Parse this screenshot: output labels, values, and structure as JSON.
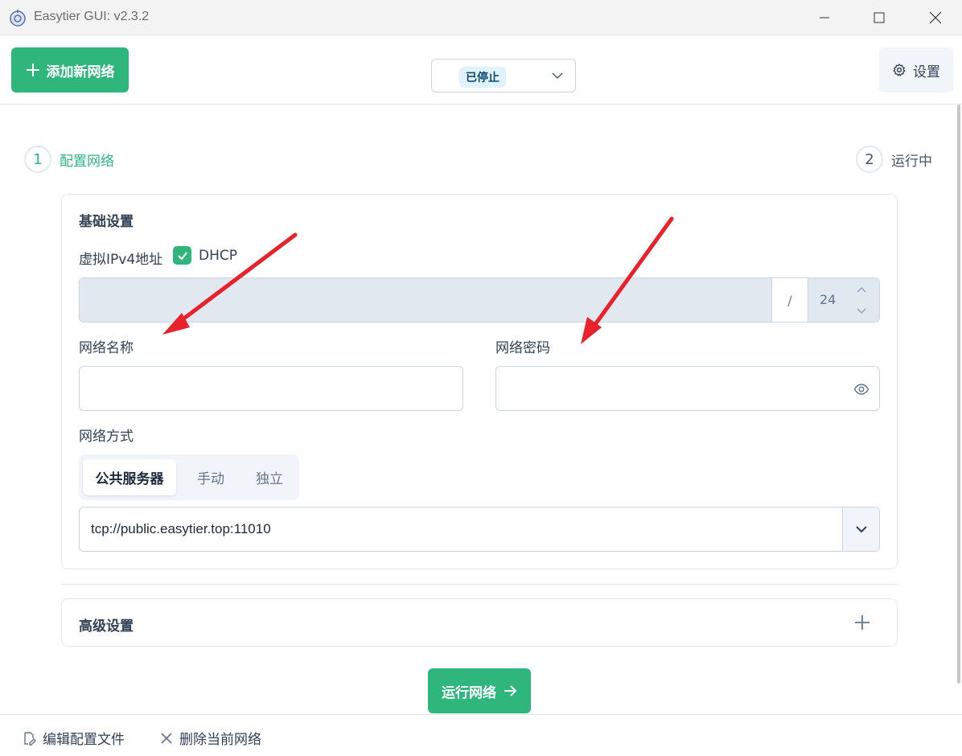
{
  "window": {
    "title": "Easytier GUI: v2.3.2"
  },
  "toolbar": {
    "add_network_label": "添加新网络",
    "status_label": "已停止",
    "settings_label": "设置"
  },
  "stepper": {
    "step1_num": "1",
    "step1_label": "配置网络",
    "step2_num": "2",
    "step2_label": "运行中"
  },
  "basic": {
    "title": "基础设置",
    "ipv4_label": "虚拟IPv4地址",
    "dhcp_label": "DHCP",
    "dhcp_checked": true,
    "ip_value": "",
    "slash": "/",
    "mask_value": "24",
    "network_name_label": "网络名称",
    "network_name_value": "",
    "network_secret_label": "网络密码",
    "network_secret_value": "",
    "network_mode_label": "网络方式",
    "modes": [
      "公共服务器",
      "手动",
      "独立"
    ],
    "selected_mode": "公共服务器",
    "server_value": "tcp://public.easytier.top:11010"
  },
  "advanced": {
    "title": "高级设置"
  },
  "run_label": "运行网络",
  "footer": {
    "edit_config_label": "编辑配置文件",
    "delete_network_label": "删除当前网络"
  },
  "colors": {
    "primary": "#2eb67d",
    "annotation_arrow": "#e8212b"
  },
  "icons": [
    "app-logo-icon",
    "minimize-icon",
    "maximize-icon",
    "close-icon",
    "plus-icon",
    "chevron-down-icon",
    "gear-icon",
    "check-icon",
    "eye-icon",
    "arrow-right-icon",
    "edit-file-icon",
    "x-icon"
  ]
}
